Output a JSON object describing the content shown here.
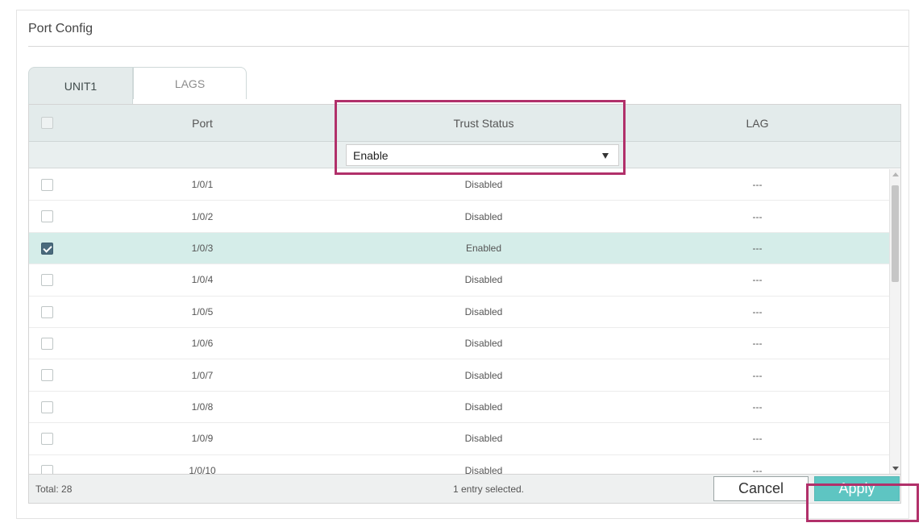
{
  "panel": {
    "title": "Port Config"
  },
  "tabs": [
    {
      "label": "UNIT1",
      "active": true
    },
    {
      "label": "LAGS",
      "active": false
    }
  ],
  "table": {
    "headers": {
      "port": "Port",
      "trust_status": "Trust Status",
      "lag": "LAG"
    },
    "filter": {
      "trust_status_selected": "Enable"
    },
    "rows": [
      {
        "port": "1/0/1",
        "trust_status": "Disabled",
        "lag": "---",
        "checked": false
      },
      {
        "port": "1/0/2",
        "trust_status": "Disabled",
        "lag": "---",
        "checked": false
      },
      {
        "port": "1/0/3",
        "trust_status": "Enabled",
        "lag": "---",
        "checked": true
      },
      {
        "port": "1/0/4",
        "trust_status": "Disabled",
        "lag": "---",
        "checked": false
      },
      {
        "port": "1/0/5",
        "trust_status": "Disabled",
        "lag": "---",
        "checked": false
      },
      {
        "port": "1/0/6",
        "trust_status": "Disabled",
        "lag": "---",
        "checked": false
      },
      {
        "port": "1/0/7",
        "trust_status": "Disabled",
        "lag": "---",
        "checked": false
      },
      {
        "port": "1/0/8",
        "trust_status": "Disabled",
        "lag": "---",
        "checked": false
      },
      {
        "port": "1/0/9",
        "trust_status": "Disabled",
        "lag": "---",
        "checked": false
      },
      {
        "port": "1/0/10",
        "trust_status": "Disabled",
        "lag": "---",
        "checked": false
      }
    ]
  },
  "footer": {
    "total": "Total: 28",
    "selection": "1 entry selected.",
    "cancel_label": "Cancel",
    "apply_label": "Apply"
  },
  "colors": {
    "selected_row": "#d5ede9",
    "apply_button": "#5ec5c2",
    "highlight_border": "#b1306a",
    "header_bg": "#e3ebeb"
  }
}
